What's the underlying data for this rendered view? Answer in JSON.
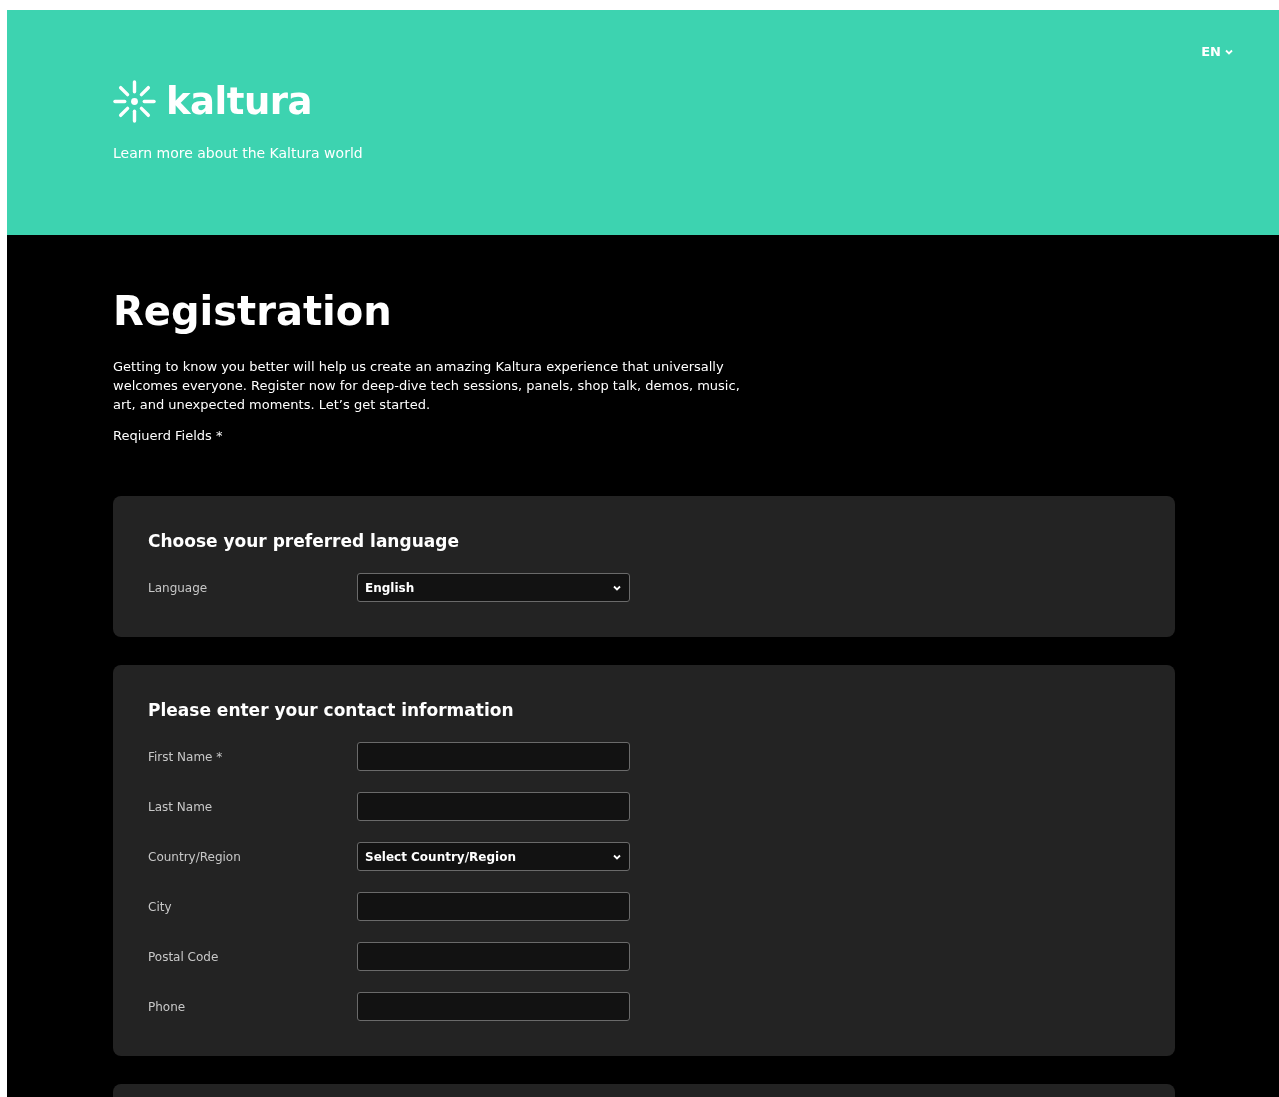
{
  "header": {
    "brand": "kaltura",
    "tagline": "Learn more about the Kaltura world",
    "language_menu": "EN"
  },
  "title": "Registration",
  "intro": "Getting to know you better will help us create an amazing Kaltura experience that universally welcomes everyone. Register now for deep-dive tech sessions, panels, shop talk, demos, music, art, and unexpected moments. Let’s get started.",
  "required_note": "Reqiuerd Fields *",
  "sections": [
    {
      "title": "Choose your preferred language",
      "fields": [
        {
          "label": "Language",
          "kind": "select",
          "value": "English"
        }
      ]
    },
    {
      "title": "Please enter your contact information",
      "fields": [
        {
          "label": "First Name *",
          "kind": "text"
        },
        {
          "label": "Last Name",
          "kind": "text"
        },
        {
          "label": "Country/Region",
          "kind": "select",
          "value": "Select Country/Region"
        },
        {
          "label": "City",
          "kind": "text"
        },
        {
          "label": "Postal Code",
          "kind": "text"
        },
        {
          "label": "Phone",
          "kind": "text"
        }
      ]
    }
  ]
}
